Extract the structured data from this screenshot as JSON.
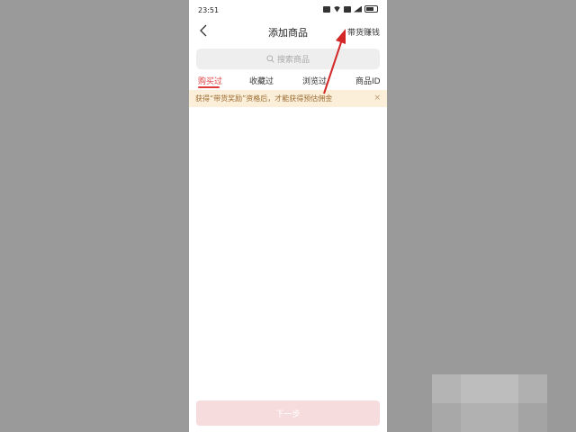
{
  "status_bar": {
    "time": "23:51"
  },
  "nav": {
    "title": "添加商品",
    "right_action": "带货赚钱"
  },
  "search": {
    "placeholder": "搜索商品"
  },
  "tabs": [
    {
      "label": "购买过",
      "active": true
    },
    {
      "label": "收藏过",
      "active": false
    },
    {
      "label": "浏览过",
      "active": false
    },
    {
      "label": "商品ID",
      "active": false
    }
  ],
  "notice": {
    "text": "获得“带货奖励”资格后，才能获得预估佣金",
    "close": "×"
  },
  "footer": {
    "next_label": "下一步"
  },
  "colors": {
    "accent": "#e03b3b",
    "notice_bg": "#fcefd9",
    "annotation_arrow": "#d32626"
  }
}
